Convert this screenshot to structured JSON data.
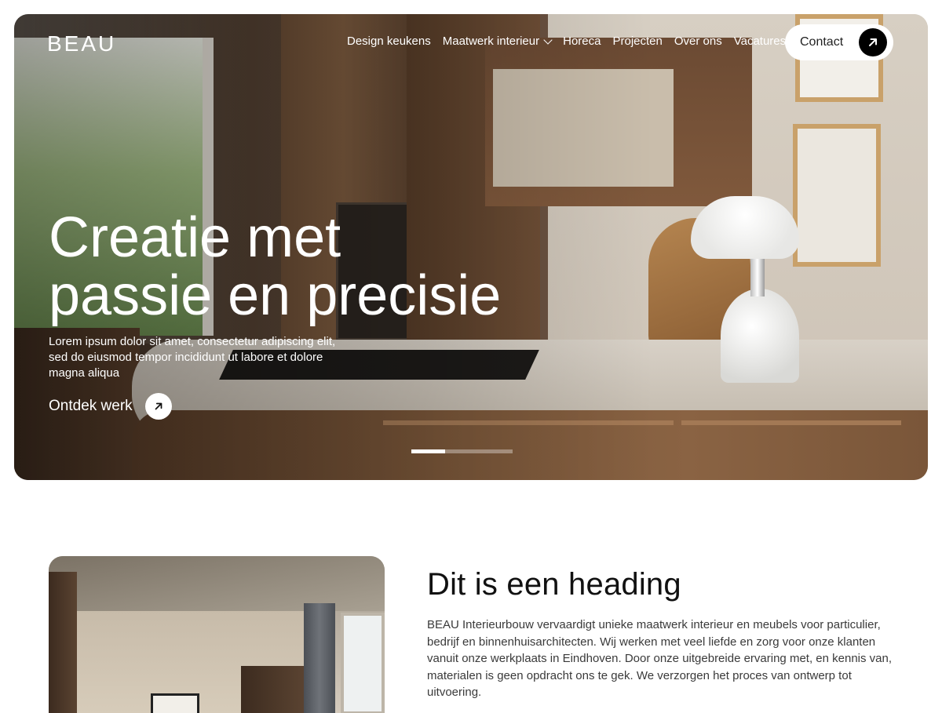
{
  "header": {
    "logo": "BEAU",
    "nav": [
      {
        "label": "Design keukens"
      },
      {
        "label": "Maatwerk interieur",
        "has_dropdown": true
      },
      {
        "label": "Horeca"
      },
      {
        "label": "Projecten"
      },
      {
        "label": "Over ons"
      },
      {
        "label": "Vacatures"
      }
    ],
    "contact_label": "Contact"
  },
  "hero": {
    "title_line1": "Creatie met",
    "title_line2": "passie en precisie",
    "text_line1": "Lorem ipsum dolor sit amet, consectetur adipiscing elit,",
    "text_line2": "sed do eiusmod tempor incididunt ut labore et dolore",
    "text_line3": "magna aliqua",
    "cta_label": "Ontdek werk",
    "slides": {
      "count": 3,
      "active": 1
    }
  },
  "intro": {
    "heading": "Dit is een heading",
    "text": "BEAU Interieurbouw vervaardigt unieke maatwerk interieur en meubels voor particulier, bedrijf en binnenhuisarchitecten. Wij werken met veel liefde en zorg voor onze klanten vanuit onze werkplaats in Eindhoven. Door onze uitgebreide ervaring met, en kennis van, materialen is geen opdracht ons te gek. We verzorgen het proces van ontwerp tot uitvoering."
  },
  "icons": {
    "contact": "arrow-up-right-icon",
    "cta": "arrow-up-right-icon",
    "dropdown": "chevron-down-icon"
  },
  "colors": {
    "accent": "#000000",
    "text_dark": "#111111",
    "text_light": "#ffffff"
  }
}
